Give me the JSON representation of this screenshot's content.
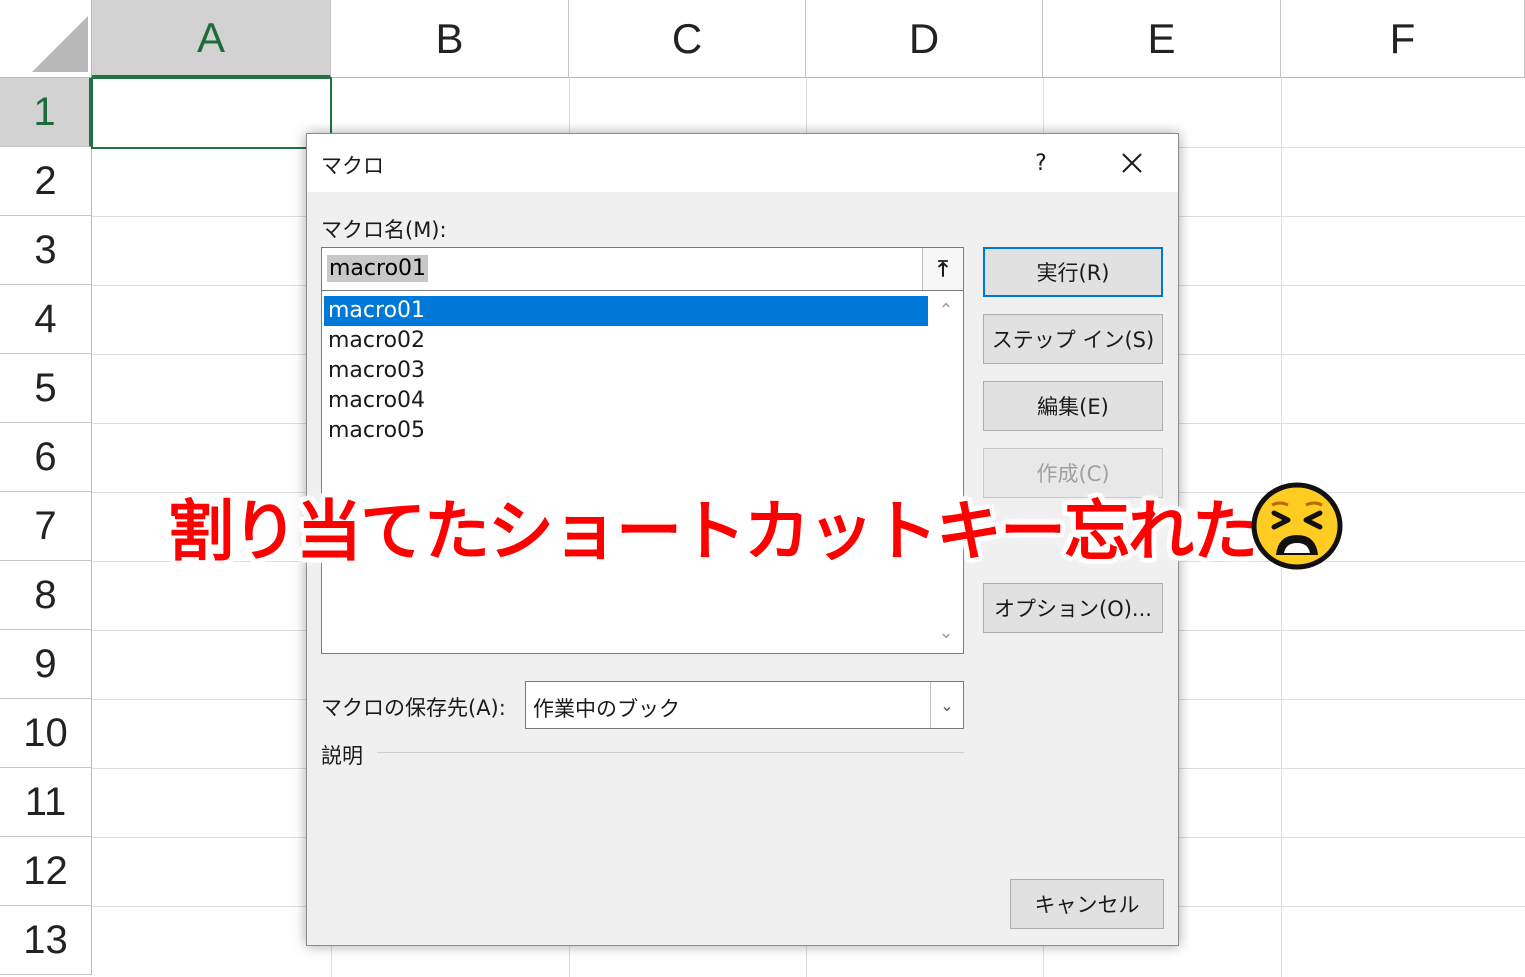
{
  "sheet": {
    "columns": [
      "A",
      "B",
      "C",
      "D",
      "E",
      "F"
    ],
    "rows": [
      "1",
      "2",
      "3",
      "4",
      "5",
      "6",
      "7",
      "8",
      "9",
      "10",
      "11",
      "12",
      "13"
    ],
    "selected_column": "A",
    "selected_row": "1",
    "accent_color": "#217346"
  },
  "dialog": {
    "title": "マクロ",
    "help_label": "?",
    "macro_name_label": "マクロ名(M):",
    "macro_name_value": "macro01",
    "macros": [
      "macro01",
      "macro02",
      "macro03",
      "macro04",
      "macro05"
    ],
    "selected_macro": "macro01",
    "buttons": {
      "run": "実行(R)",
      "step_into": "ステップ イン(S)",
      "edit": "編集(E)",
      "create": "作成(C)",
      "options": "オプション(O)...",
      "cancel": "キャンセル"
    },
    "store_in_label": "マクロの保存先(A):",
    "store_in_value": "作業中のブック",
    "description_label": "説明",
    "selection_color": "#0078d7"
  },
  "overlay": {
    "caption": "割り当てたショートカットキー忘れた",
    "caption_color": "#ff0000",
    "emoji": "tired-face-emoji"
  }
}
